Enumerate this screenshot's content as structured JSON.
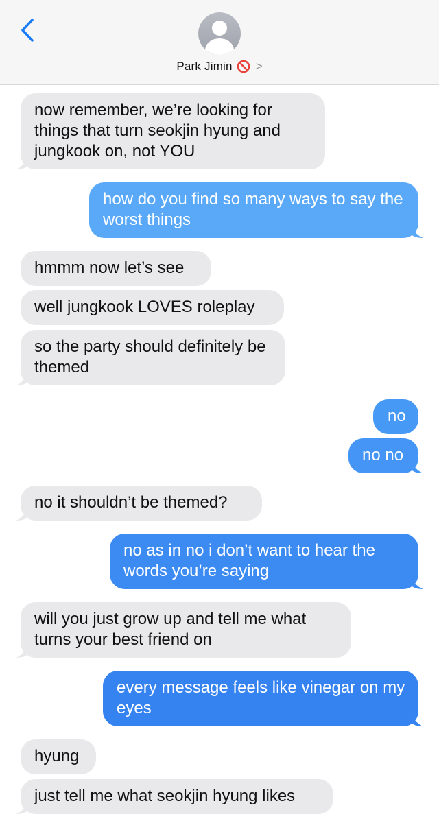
{
  "header": {
    "contact_name": "Park Jimin",
    "chevron": ">"
  },
  "messages": [
    {
      "direction": "incoming",
      "text": "now remember, we’re looking for things that turn seokjin hyung and jungkook on, not YOU",
      "color": "#e9e9eb"
    },
    {
      "direction": "outgoing",
      "text": "how do you find so many ways to say the worst things",
      "color": "#5aa9f8"
    },
    {
      "direction": "incoming",
      "text": "hmmm now let’s see",
      "color": "#e9e9eb"
    },
    {
      "direction": "incoming",
      "text": "well jungkook LOVES roleplay",
      "color": "#e9e9eb"
    },
    {
      "direction": "incoming",
      "text": "so the party should definitely be themed",
      "color": "#e9e9eb"
    },
    {
      "direction": "outgoing",
      "text": "no",
      "color": "#4799f6"
    },
    {
      "direction": "outgoing",
      "text": "no no",
      "color": "#4495f5"
    },
    {
      "direction": "incoming",
      "text": "no it shouldn’t be themed?",
      "color": "#e9e9eb"
    },
    {
      "direction": "outgoing",
      "text": "no as in no i don’t want to hear the words you’re saying",
      "color": "#3b8bf3"
    },
    {
      "direction": "incoming",
      "text": "will you just grow up and tell me what turns your best friend on",
      "color": "#e9e9eb"
    },
    {
      "direction": "outgoing",
      "text": "every message feels like vinegar on my eyes",
      "color": "#3582f1"
    },
    {
      "direction": "incoming",
      "text": "hyung",
      "color": "#e9e9eb"
    },
    {
      "direction": "incoming",
      "text": "just tell me what seokjin hyung likes",
      "color": "#e9e9eb"
    }
  ],
  "colors": {
    "accent": "#1a7cf5",
    "no_entry": "#e8453c"
  },
  "icons": [
    "back-chevron-icon",
    "contact-avatar-icon",
    "no-entry-icon",
    "chevron-right-icon"
  ]
}
